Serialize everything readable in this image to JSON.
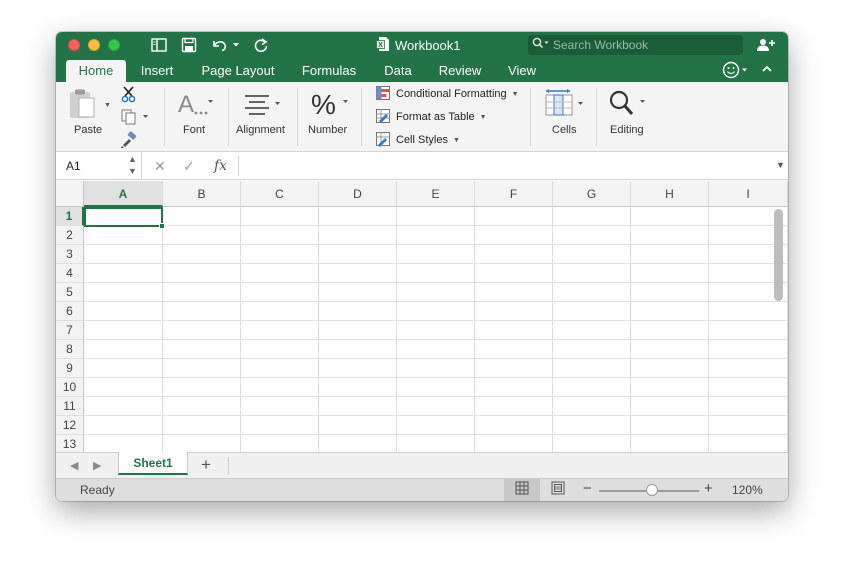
{
  "window": {
    "title": "Workbook1",
    "search_placeholder": "Search Workbook"
  },
  "tabs": [
    "Home",
    "Insert",
    "Page Layout",
    "Formulas",
    "Data",
    "Review",
    "View"
  ],
  "active_tab": "Home",
  "ribbon": {
    "paste": "Paste",
    "font": "Font",
    "alignment": "Alignment",
    "number": "Number",
    "conditional_formatting": "Conditional Formatting",
    "format_as_table": "Format as Table",
    "cell_styles": "Cell Styles",
    "cells": "Cells",
    "editing": "Editing"
  },
  "formula_bar": {
    "name_box": "A1",
    "fx": "fx",
    "value": ""
  },
  "grid": {
    "columns": [
      "A",
      "B",
      "C",
      "D",
      "E",
      "F",
      "G",
      "H",
      "I"
    ],
    "rows": [
      "1",
      "2",
      "3",
      "4",
      "5",
      "6",
      "7",
      "8",
      "9",
      "10",
      "11",
      "12",
      "13"
    ],
    "selected_cell": "A1"
  },
  "sheets": [
    "Sheet1"
  ],
  "active_sheet": "Sheet1",
  "status": {
    "text": "Ready",
    "zoom": "120%",
    "zoom_level_fraction": 0.53
  },
  "colors": {
    "accent": "#227447",
    "ribbon_bg": "#f4f4f4"
  }
}
